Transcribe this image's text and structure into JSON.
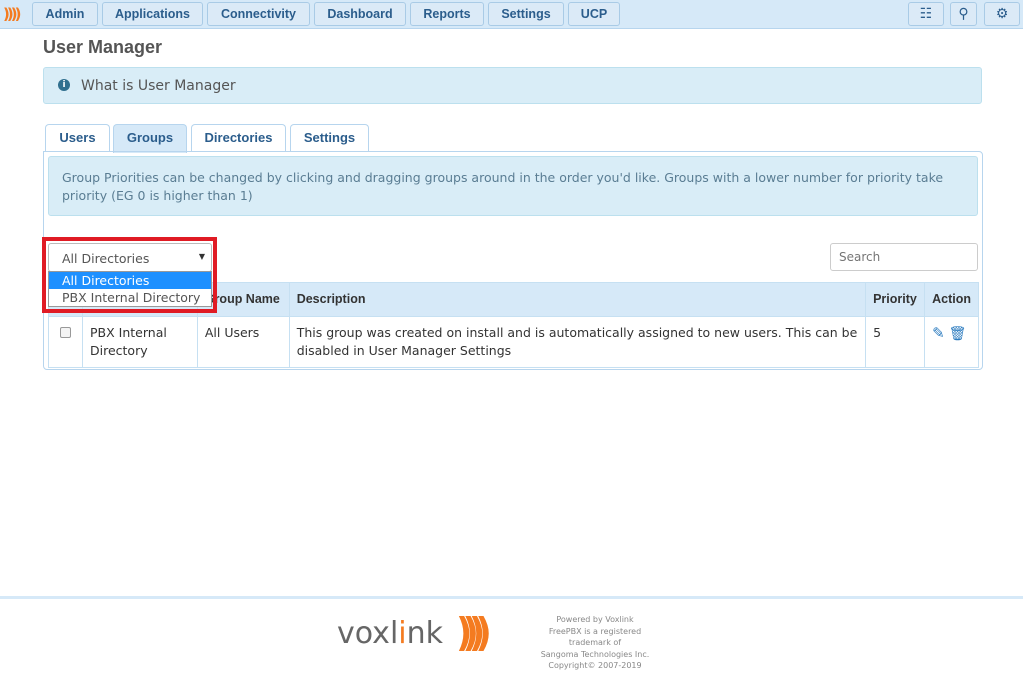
{
  "nav": {
    "items": [
      "Admin",
      "Applications",
      "Connectivity",
      "Dashboard",
      "Reports",
      "Settings",
      "UCP"
    ],
    "icons": [
      "language-icon",
      "search-icon",
      "gear-icon"
    ]
  },
  "page_title": "User Manager",
  "info_label": "What is User Manager",
  "tabs": [
    "Users",
    "Groups",
    "Directories",
    "Settings"
  ],
  "active_tab": "Groups",
  "alert": "Group Priorities can be changed by clicking and dragging groups around in the order you'd like. Groups with a lower number for priority take priority (EG 0 is higher than 1)",
  "directory_select": {
    "value": "All Directories",
    "options": [
      "All Directories",
      "PBX Internal Directory"
    ]
  },
  "search_placeholder": "Search",
  "table": {
    "headers": [
      "",
      "Group Name",
      "Description",
      "Priority",
      "Action"
    ],
    "rows": [
      {
        "directory": "PBX Internal Directory",
        "group": "All Users",
        "description": "This group was created on install and is automatically assigned to new users. This can be disabled in User Manager Settings",
        "priority": "5"
      }
    ]
  },
  "footer": {
    "brand": "voxlink",
    "lines": [
      "Powered by Voxlink",
      "FreePBX is a registered trademark of",
      "Sangoma Technologies Inc.",
      "Copyright© 2007-2019"
    ]
  },
  "colors": {
    "accent": "#2b5d8c",
    "brand": "#f47b20",
    "highlight": "#e01b24"
  }
}
